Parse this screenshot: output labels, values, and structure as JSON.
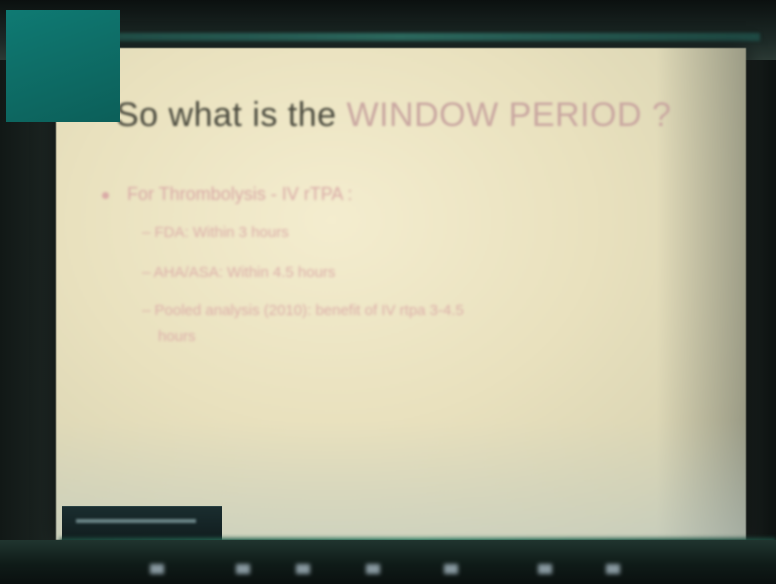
{
  "slide": {
    "title_prefix": "So what is the ",
    "title_accent": "WINDOW PERIOD ?",
    "bullet": "For Thrombolysis - IV rTPA :",
    "subpoints": [
      "– FDA: Within 3 hours",
      "– AHA/ASA: Within 4.5 hours",
      "– Pooled analysis (2010): benefit of IV rtpa 3-4.5",
      "hours"
    ]
  },
  "colors": {
    "slide_bg": "#efe8c8",
    "title_text": "#4a4a3e",
    "accent_text": "#c9a7a1",
    "teal_block": "#0f7a73",
    "taskbar": "#0f1b18"
  }
}
